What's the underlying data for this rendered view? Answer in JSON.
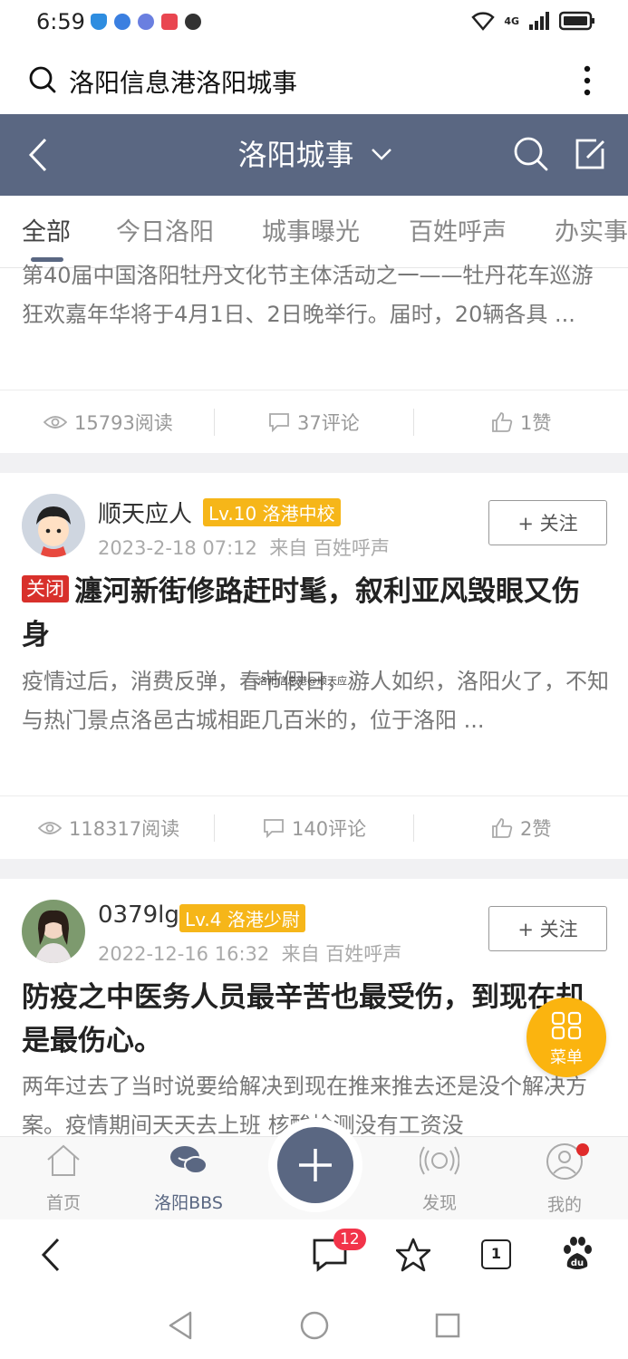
{
  "status_bar": {
    "time": "6:59",
    "network": "4G"
  },
  "browser": {
    "search_text": "洛阳信息港洛阳城事"
  },
  "header": {
    "title": "洛阳城事"
  },
  "tabs": [
    "全部",
    "今日洛阳",
    "城事曝光",
    "百姓呼声",
    "办实事"
  ],
  "posts": [
    {
      "excerpt": "第40届中国洛阳牡丹文化节主体活动之一——牡丹花车巡游狂欢嘉年华将于4月1日、2日晚举行。届时，20辆各具 ...",
      "views": "15793阅读",
      "comments": "37评论",
      "likes": "1赞"
    },
    {
      "author": "顺天应人",
      "level": "Lv.10 洛港中校",
      "date": "2023-2-18 07:12",
      "source": "来自 百姓呼声",
      "follow_label": "+ 关注",
      "tag": "关闭",
      "title": "瀍河新街修路赶时髦，叙利亚风毁眼又伤身",
      "excerpt": "疫情过后，消费反弹，春节假日，游人如织，洛阳火了，不知与热门景点洛邑古城相距几百米的，位于洛阳 ...",
      "watermark": "洛阳信息港@顺天应人",
      "views": "118317阅读",
      "comments": "140评论",
      "likes": "2赞"
    },
    {
      "author": "0379lg",
      "level": "Lv.4 洛港少尉",
      "date": "2022-12-16 16:32",
      "source": "来自 百姓呼声",
      "follow_label": "+ 关注",
      "title": "防疫之中医务人员最辛苦也最受伤，到现在却是最伤心。",
      "excerpt": "两年过去了当时说要给解决到现在推来推去还是没个解决方案。疫情期间天天去上班 核酸检测没有工资没"
    }
  ],
  "float_menu": {
    "label": "菜单"
  },
  "bottom_nav": {
    "items": [
      "首页",
      "洛阳BBS",
      "发现",
      "我的"
    ]
  },
  "browser_toolbar": {
    "message_count": "12",
    "tab_count": "1"
  }
}
